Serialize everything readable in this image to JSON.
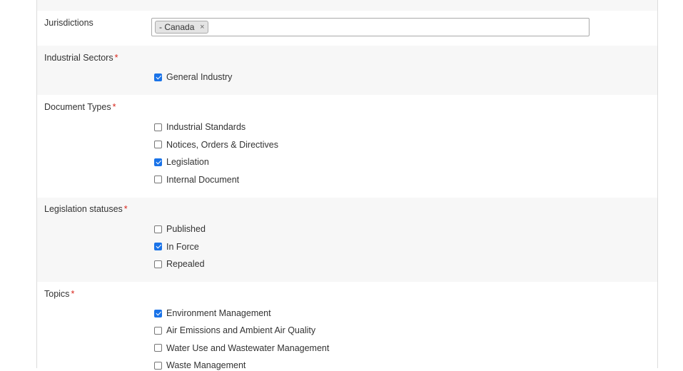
{
  "fields": {
    "jurisdictions": {
      "label": "Jurisdictions",
      "tag": "- Canada",
      "tag_remove": "×"
    },
    "industrial_sectors": {
      "label": "Industrial Sectors",
      "required_mark": "*",
      "options": [
        {
          "label": "General Industry",
          "checked": true
        }
      ]
    },
    "document_types": {
      "label": "Document Types",
      "required_mark": "*",
      "options": [
        {
          "label": "Industrial Standards",
          "checked": false
        },
        {
          "label": "Notices, Orders & Directives",
          "checked": false
        },
        {
          "label": "Legislation",
          "checked": true
        },
        {
          "label": "Internal Document",
          "checked": false
        }
      ]
    },
    "legislation_statuses": {
      "label": "Legislation statuses",
      "required_mark": "*",
      "options": [
        {
          "label": "Published",
          "checked": false
        },
        {
          "label": "In Force",
          "checked": true
        },
        {
          "label": "Repealed",
          "checked": false
        }
      ]
    },
    "topics": {
      "label": "Topics",
      "required_mark": "*",
      "options": [
        {
          "label": "Environment Management",
          "checked": true
        },
        {
          "label": "Air Emissions and Ambient Air Quality",
          "checked": false
        },
        {
          "label": "Water Use and Wastewater Management",
          "checked": false
        },
        {
          "label": "Waste Management",
          "checked": false
        }
      ]
    }
  },
  "colors": {
    "required": "#d9261c",
    "checkbox_checked": "#1a73e8",
    "row_shade": "#f7f7f7"
  }
}
